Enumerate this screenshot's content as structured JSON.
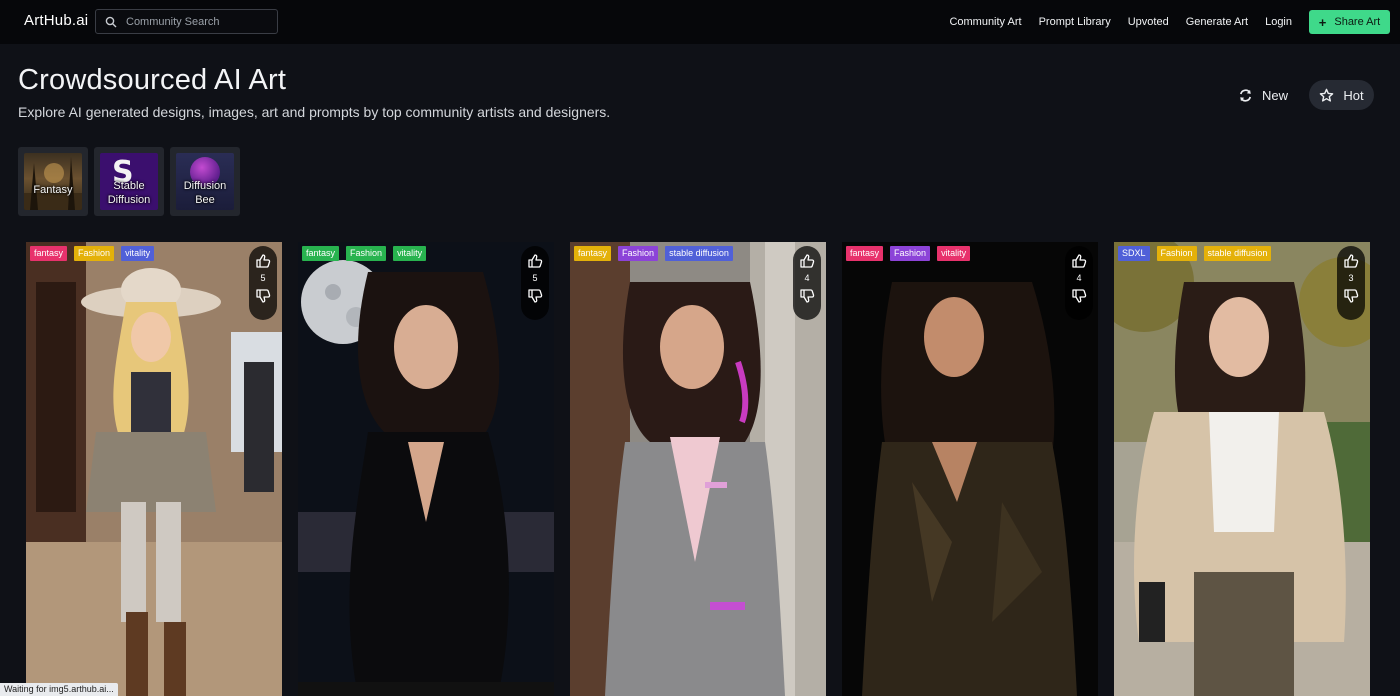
{
  "nav": {
    "brand": "ArtHub.ai",
    "search_placeholder": "Community Search",
    "links": [
      "Community Art",
      "Prompt Library",
      "Upvoted",
      "Generate Art",
      "Login"
    ],
    "share_label": "Share Art",
    "share_color": "#3fd98a"
  },
  "hero": {
    "title": "Crowdsourced AI Art",
    "subtitle": "Explore AI generated designs, images, art and prompts by top community artists and designers.",
    "sort_new": "New",
    "sort_hot": "Hot"
  },
  "categories": [
    {
      "label": "Fantasy"
    },
    {
      "label": "Stable Diffusion"
    },
    {
      "label": "Diffusion Bee"
    }
  ],
  "cards": [
    {
      "tags": [
        "fantasy",
        "Fashion",
        "vitality"
      ],
      "votes": "5",
      "art": "cowgirl-costume-portrait"
    },
    {
      "tags": [
        "fantasy",
        "Fashion",
        "vitality"
      ],
      "votes": "5",
      "art": "latex-catsuit-moon-portrait"
    },
    {
      "tags": [
        "fantasy",
        "Fashion",
        "stable diffusion"
      ],
      "votes": "4",
      "art": "grey-blazer-portrait"
    },
    {
      "tags": [
        "fantasy",
        "Fashion",
        "vitality"
      ],
      "votes": "4",
      "art": "dark-robe-portrait"
    },
    {
      "tags": [
        "SDXL",
        "Fashion",
        "stable diffusion"
      ],
      "votes": "3",
      "art": "cardigan-street-portrait"
    }
  ],
  "status": "Waiting for img5.arthub.ai..."
}
